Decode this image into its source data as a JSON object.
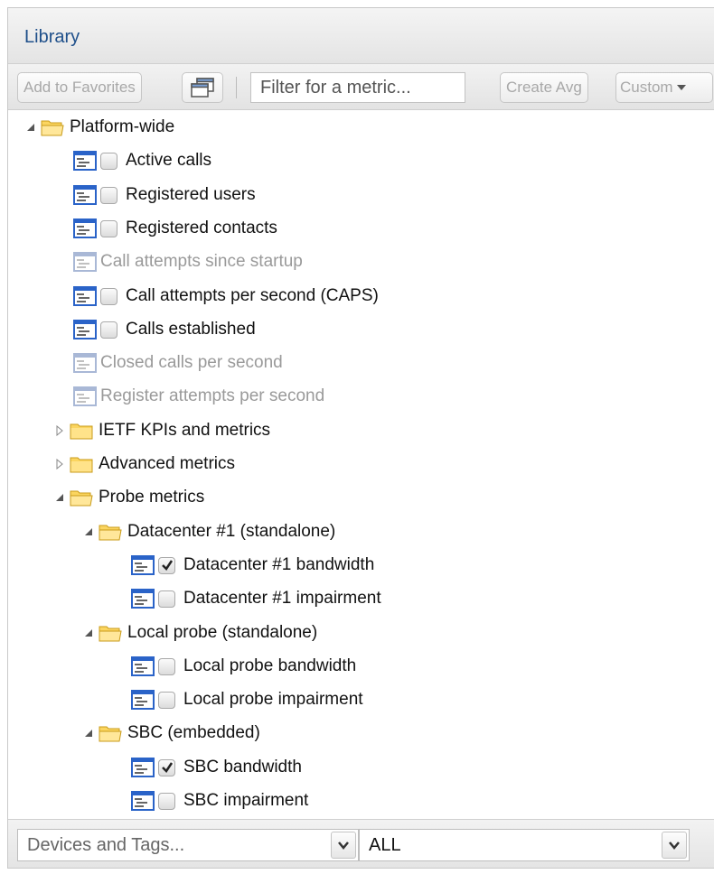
{
  "panel": {
    "title": "Library"
  },
  "toolbar": {
    "add_favorites": "Add to Favorites",
    "filter_placeholder": "Filter for a metric...",
    "create_avg": "Create Avg",
    "custom": "Custom"
  },
  "tree": [
    {
      "label": "Platform-wide",
      "type": "folder",
      "expanded": true,
      "level": 0
    },
    {
      "label": "Active calls",
      "type": "metric",
      "checked": false,
      "enabled": true,
      "level": 2
    },
    {
      "label": "Registered users",
      "type": "metric",
      "checked": false,
      "enabled": true,
      "level": 2
    },
    {
      "label": "Registered contacts",
      "type": "metric",
      "checked": false,
      "enabled": true,
      "level": 2
    },
    {
      "label": "Call attempts since startup",
      "type": "metric",
      "checked": false,
      "enabled": false,
      "level": 2
    },
    {
      "label": "Call attempts per second (CAPS)",
      "type": "metric",
      "checked": false,
      "enabled": true,
      "level": 2
    },
    {
      "label": "Calls established",
      "type": "metric",
      "checked": false,
      "enabled": true,
      "level": 2
    },
    {
      "label": "Closed calls per second",
      "type": "metric",
      "checked": false,
      "enabled": false,
      "level": 2
    },
    {
      "label": "Register attempts per second",
      "type": "metric",
      "checked": false,
      "enabled": false,
      "level": 2
    },
    {
      "label": "IETF KPIs and metrics",
      "type": "folder",
      "expanded": false,
      "level": 1
    },
    {
      "label": "Advanced metrics",
      "type": "folder",
      "expanded": false,
      "level": 1
    },
    {
      "label": "Probe metrics",
      "type": "folder",
      "expanded": true,
      "level": 1
    },
    {
      "label": "Datacenter #1 (standalone)",
      "type": "folder",
      "expanded": true,
      "level": 2
    },
    {
      "label": "Datacenter #1 bandwidth",
      "type": "metric",
      "checked": true,
      "enabled": true,
      "level": 4
    },
    {
      "label": "Datacenter #1 impairment",
      "type": "metric",
      "checked": false,
      "enabled": true,
      "level": 4
    },
    {
      "label": "Local probe (standalone)",
      "type": "folder",
      "expanded": true,
      "level": 2
    },
    {
      "label": "Local probe bandwidth",
      "type": "metric",
      "checked": false,
      "enabled": true,
      "level": 4
    },
    {
      "label": "Local probe impairment",
      "type": "metric",
      "checked": false,
      "enabled": true,
      "level": 4
    },
    {
      "label": "SBC (embedded)",
      "type": "folder",
      "expanded": true,
      "level": 2
    },
    {
      "label": "SBC bandwidth",
      "type": "metric",
      "checked": true,
      "enabled": true,
      "level": 4
    },
    {
      "label": "SBC impairment",
      "type": "metric",
      "checked": false,
      "enabled": true,
      "level": 4
    }
  ],
  "bottom": {
    "devices_placeholder": "Devices and Tags...",
    "scope_value": "ALL"
  },
  "colors": {
    "title": "#1e4f8a",
    "folder_fill": "#fbd560",
    "metric_icon": "#2a63c8",
    "disabled_text": "#9a9a9a"
  }
}
